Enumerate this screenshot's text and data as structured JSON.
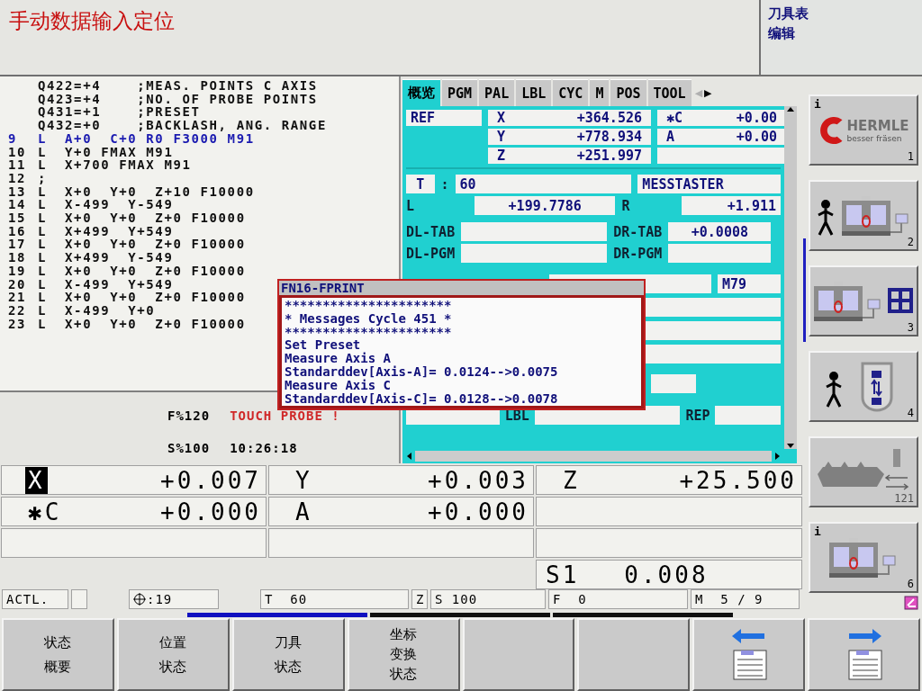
{
  "header": {
    "title": "手动数据输入定位",
    "side_lines": [
      "刀具表",
      "编辑"
    ]
  },
  "program": {
    "lines": [
      {
        "text": "Q422=+4    ;MEAS. POINTS C AXIS",
        "current": false
      },
      {
        "text": "Q423=+4    ;NO. OF PROBE POINTS",
        "current": false
      },
      {
        "text": "Q431=+1    ;PRESET",
        "current": false
      },
      {
        "text": "Q432=+0    ;BACKLASH, ANG. RANGE",
        "current": false
      },
      {
        "number": "9",
        "text": "L  A+0  C+0 R0 F3000 M91",
        "current": true
      },
      {
        "number": "10",
        "text": "L  Y+0 FMAX M91",
        "current": false
      },
      {
        "number": "11",
        "text": "L  X+700 FMAX M91",
        "current": false
      },
      {
        "number": "12",
        "text": ";",
        "current": false
      },
      {
        "number": "13",
        "text": "L  X+0  Y+0  Z+10 F10000",
        "current": false
      },
      {
        "number": "14",
        "text": "L  X-499  Y-549",
        "current": false
      },
      {
        "number": "15",
        "text": "L  X+0  Y+0  Z+0 F10000",
        "current": false
      },
      {
        "number": "16",
        "text": "L  X+499  Y+549",
        "current": false
      },
      {
        "number": "17",
        "text": "L  X+0  Y+0  Z+0 F10000",
        "current": false
      },
      {
        "number": "18",
        "text": "L  X+499  Y-549",
        "current": false
      },
      {
        "number": "19",
        "text": "L  X+0  Y+0  Z+0 F10000",
        "current": false
      },
      {
        "number": "20",
        "text": "L  X-499  Y+549",
        "current": false
      },
      {
        "number": "21",
        "text": "L  X+0  Y+0  Z+0 F10000",
        "current": false
      },
      {
        "number": "22",
        "text": "L  X-499  Y+0",
        "current": false
      },
      {
        "number": "23",
        "text": "L  X+0  Y+0  Z+0 F10000",
        "current": false
      }
    ],
    "feed_override": "F%120",
    "message": "TOUCH PROBE !",
    "spindle_override": "S%100",
    "time": "10:26:18"
  },
  "status_panel": {
    "tabs": [
      {
        "label": "概览",
        "selected": true
      },
      {
        "label": "PGM",
        "selected": false
      },
      {
        "label": "PAL",
        "selected": false
      },
      {
        "label": "LBL",
        "selected": false
      },
      {
        "label": "CYC",
        "selected": false
      },
      {
        "label": "M",
        "selected": false
      },
      {
        "label": "POS",
        "selected": false
      },
      {
        "label": "TOOL",
        "selected": false
      }
    ],
    "tab_scroll": [
      "◀",
      "▶"
    ],
    "ref_label": "REF",
    "axes": [
      {
        "axis": "X",
        "value": "+364.526"
      },
      {
        "axis": "Y",
        "value": "+778.934"
      },
      {
        "axis": "Z",
        "value": "+251.997"
      }
    ],
    "rotary_axes": [
      {
        "axis": "✱C",
        "value": "+0.00"
      },
      {
        "axis": "A",
        "value": "+0.00"
      }
    ],
    "tool": {
      "label": "T",
      "separator": ":",
      "number": "60",
      "name": "MESSTASTER"
    },
    "fields": [
      {
        "label": "L",
        "value": "+199.7786"
      },
      {
        "label": "R",
        "value": "+1.911"
      },
      {
        "label": "DL-TAB"
      },
      {
        "label": "DR-TAB",
        "value": "+0.0008"
      },
      {
        "label": "DL-PGM"
      },
      {
        "label": "DR-PGM"
      }
    ],
    "m_code": "M79",
    "lbl_label": "LBL",
    "rep_label": "REP"
  },
  "popup": {
    "title": "FN16-FPRINT",
    "lines": [
      "**********************",
      "* Messages Cycle 451 *",
      "**********************",
      "Set Preset",
      "Measure Axis A",
      "Standarddev[Axis-A]= 0.0124-->0.0075",
      "Measure Axis C",
      "Standarddev[Axis-C]= 0.0128-->0.0078"
    ]
  },
  "positions": [
    {
      "axis": "X",
      "value": "+0.007",
      "highlighted": true
    },
    {
      "axis": "Y",
      "value": "+0.003",
      "highlighted": false
    },
    {
      "axis": "Z",
      "value": "+25.500",
      "highlighted": false
    },
    {
      "axis": "✱C",
      "value": "+0.000",
      "highlighted": false
    },
    {
      "axis": "A",
      "value": "+0.000",
      "highlighted": false
    }
  ],
  "spindle": {
    "label": "S1",
    "value": "0.008"
  },
  "status_bar": {
    "mode": "ACTL.",
    "datum": ":19",
    "tool": "T  60",
    "tool_axis": "Z",
    "speed": "S 100",
    "feed": "F  0",
    "m_function": "M  5 / 9"
  },
  "side_softkeys": [
    {
      "kind": "logo",
      "info": "i",
      "number": "1",
      "brand": "HERMLE",
      "slogan": "besser fräsen"
    },
    {
      "kind": "operator-machine",
      "number": "2"
    },
    {
      "kind": "machine-grid",
      "number": "3"
    },
    {
      "kind": "operator-spindle",
      "number": "4"
    },
    {
      "kind": "gear-milling",
      "number": "121"
    },
    {
      "kind": "machine",
      "info": "i",
      "number": "6"
    }
  ],
  "softkey_pages": [
    {
      "selected": true
    },
    {
      "selected": false
    },
    {
      "selected": false
    }
  ],
  "softkeys": [
    {
      "kind": "text",
      "lines": [
        "状态",
        "概要"
      ]
    },
    {
      "kind": "text",
      "lines": [
        "位置",
        "状态"
      ]
    },
    {
      "kind": "text",
      "lines": [
        "刀具",
        "状态"
      ]
    },
    {
      "kind": "text",
      "lines": [
        "坐标",
        "变换",
        "状态"
      ]
    },
    {
      "kind": "blank"
    },
    {
      "kind": "blank"
    },
    {
      "kind": "page-back"
    },
    {
      "kind": "page-forward"
    }
  ]
}
